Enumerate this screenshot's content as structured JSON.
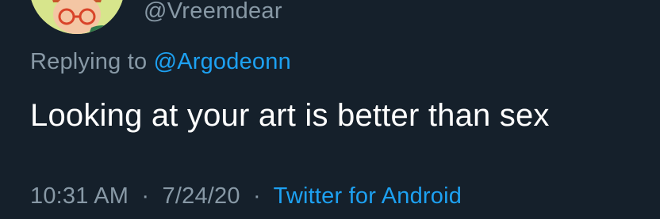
{
  "tweet": {
    "handle": "@Vreemdear",
    "reply_prefix": "Replying to",
    "reply_to": "@Argodeonn",
    "text": "Looking at your art is better than sex",
    "time": "10:31 AM",
    "separator": "·",
    "date": "7/24/20",
    "source": "Twitter for Android"
  },
  "colors": {
    "background": "#15202b",
    "secondary_text": "#8899a6",
    "primary_text": "#ffffff",
    "link": "#1da1f2",
    "avatar_bg": "#d7e58c"
  }
}
